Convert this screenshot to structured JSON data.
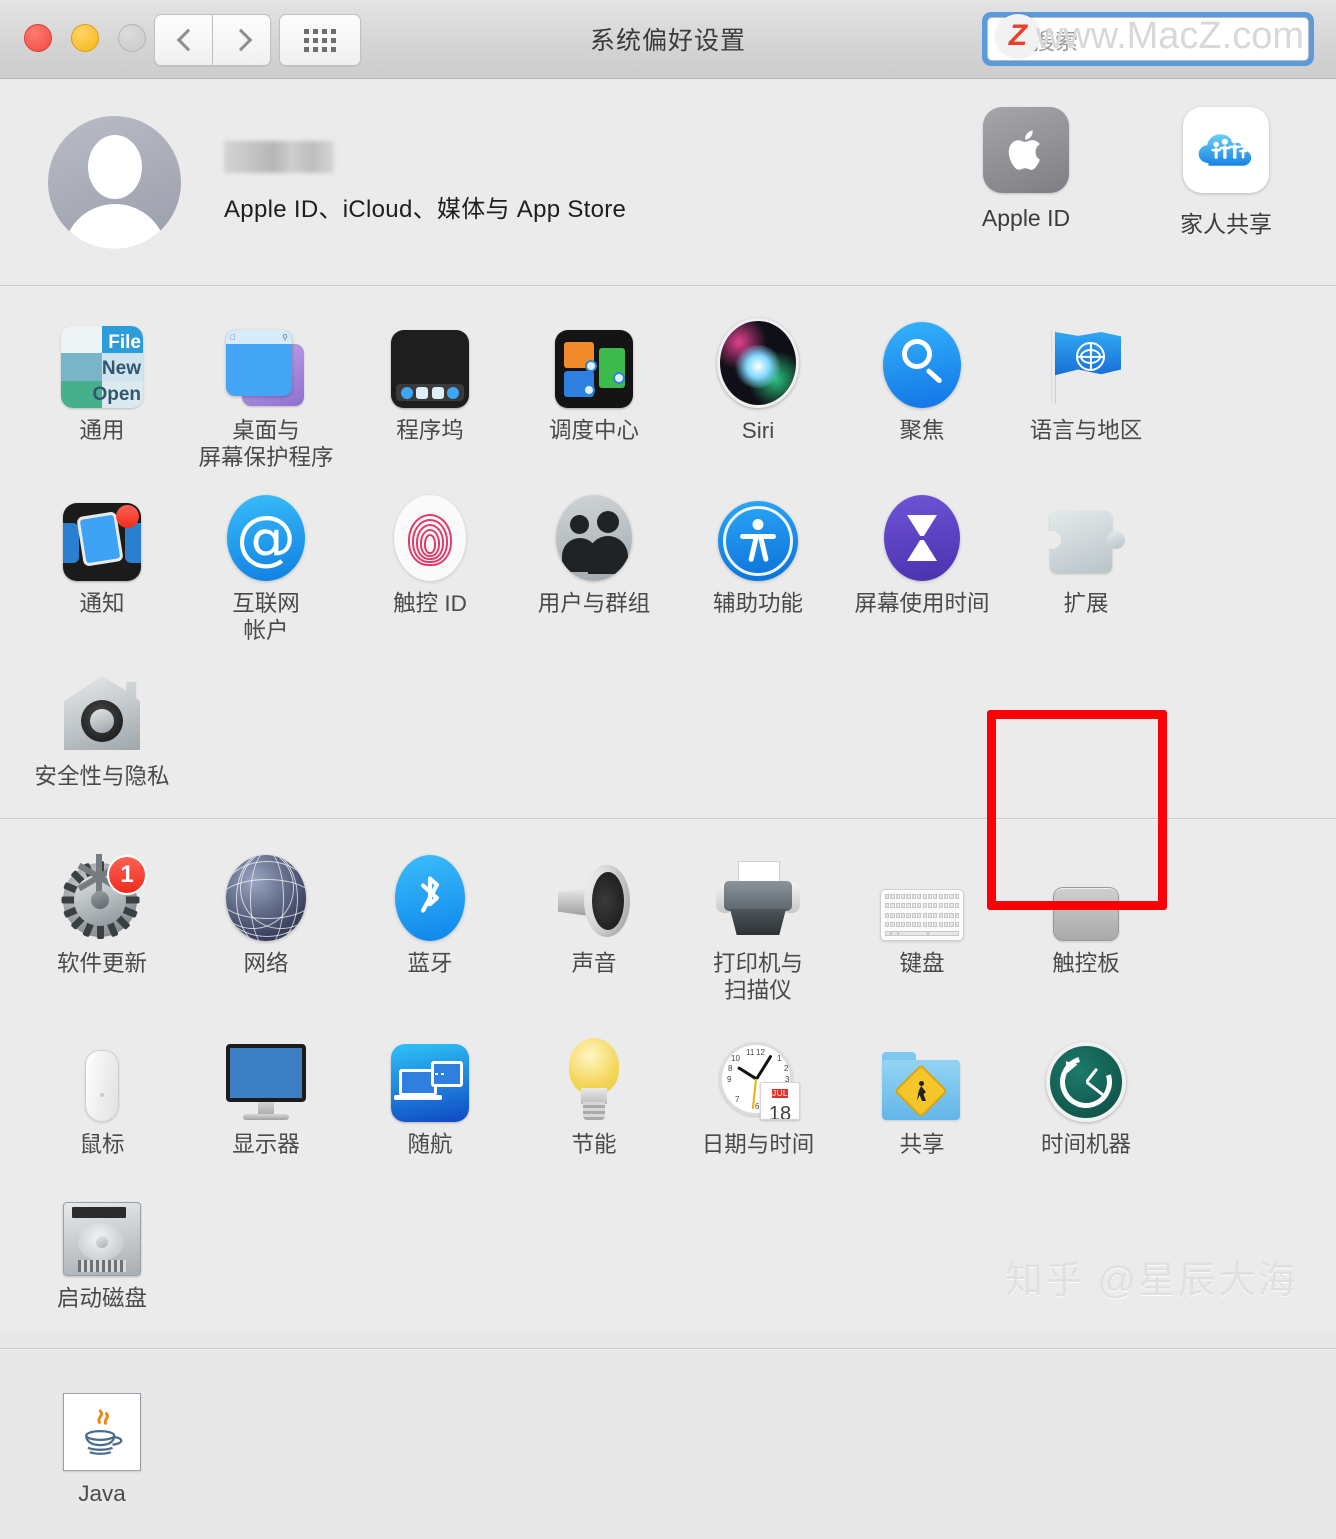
{
  "window": {
    "title": "系统偏好设置",
    "traffic_lights": [
      "close",
      "minimize",
      "zoom"
    ],
    "nav": {
      "back": "‹",
      "forward": "›",
      "show_all": "show-all-grid"
    }
  },
  "search": {
    "placeholder": "搜索",
    "value": "",
    "focused": true,
    "focus_color": "#5b9bdb"
  },
  "watermarks": {
    "top": {
      "logo": "Z",
      "text": "www.MacZ.com"
    },
    "bottom": "知乎 @星辰大海"
  },
  "account": {
    "name_redacted": true,
    "subtitle": "Apple ID、iCloud、媒体与 App Store",
    "tiles": [
      {
        "label": "Apple ID",
        "icon": "apple-logo-icon"
      },
      {
        "label": "家人共享",
        "icon": "family-cloud-icon"
      }
    ]
  },
  "sections": [
    {
      "id": "section-personal",
      "panes": [
        {
          "label": "通用",
          "icon": "general-icon"
        },
        {
          "label": "桌面与\n屏幕保护程序",
          "icon": "desktop-screensaver-icon"
        },
        {
          "label": "程序坞",
          "icon": "dock-icon"
        },
        {
          "label": "调度中心",
          "icon": "mission-control-icon"
        },
        {
          "label": "Siri",
          "icon": "siri-icon"
        },
        {
          "label": "聚焦",
          "icon": "spotlight-icon"
        },
        {
          "label": "语言与地区",
          "icon": "language-region-flag-icon"
        },
        {
          "label": "通知",
          "icon": "notifications-icon",
          "badge": ""
        },
        {
          "label": "互联网\n帐户",
          "icon": "internet-accounts-at-icon"
        },
        {
          "label": "触控 ID",
          "icon": "touch-id-fingerprint-icon"
        },
        {
          "label": "用户与群组",
          "icon": "users-groups-icon"
        },
        {
          "label": "辅助功能",
          "icon": "accessibility-icon"
        },
        {
          "label": "屏幕使用时间",
          "icon": "screen-time-hourglass-icon"
        },
        {
          "label": "扩展",
          "icon": "extensions-puzzle-icon"
        },
        {
          "label": "安全性与隐私",
          "icon": "security-privacy-house-icon"
        }
      ]
    },
    {
      "id": "section-hardware",
      "panes": [
        {
          "label": "软件更新",
          "icon": "software-update-gear-icon",
          "badge": "1"
        },
        {
          "label": "网络",
          "icon": "network-globe-icon"
        },
        {
          "label": "蓝牙",
          "icon": "bluetooth-icon"
        },
        {
          "label": "声音",
          "icon": "sound-speaker-icon"
        },
        {
          "label": "打印机与\n扫描仪",
          "icon": "printers-scanners-icon"
        },
        {
          "label": "键盘",
          "icon": "keyboard-icon"
        },
        {
          "label": "触控板",
          "icon": "trackpad-icon",
          "highlighted": true
        },
        {
          "label": "鼠标",
          "icon": "mouse-icon"
        },
        {
          "label": "显示器",
          "icon": "displays-monitor-icon"
        },
        {
          "label": "随航",
          "icon": "sidecar-icon"
        },
        {
          "label": "节能",
          "icon": "energy-saver-bulb-icon"
        },
        {
          "label": "日期与时间",
          "icon": "date-time-clock-icon",
          "calendar_month": "JUL",
          "calendar_day": "18"
        },
        {
          "label": "共享",
          "icon": "sharing-folder-icon"
        },
        {
          "label": "时间机器",
          "icon": "time-machine-icon"
        },
        {
          "label": "启动磁盘",
          "icon": "startup-disk-icon"
        }
      ]
    },
    {
      "id": "section-other",
      "panes": [
        {
          "label": "Java",
          "icon": "java-coffee-icon"
        }
      ]
    }
  ],
  "highlight": {
    "target_label": "触控板",
    "color": "#fb0007"
  }
}
